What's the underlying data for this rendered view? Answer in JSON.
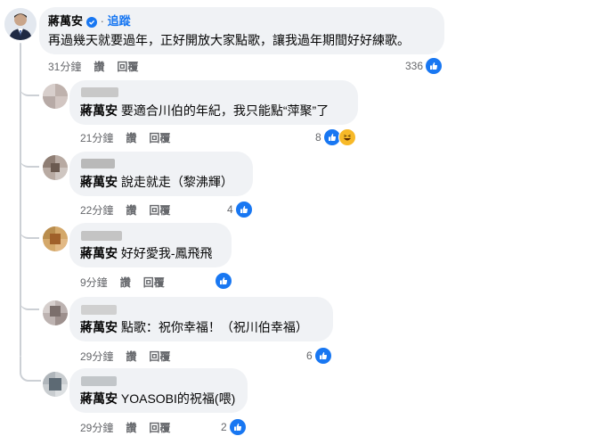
{
  "post": {
    "author": "蔣萬安",
    "separator": " · ",
    "follow_label": "追蹤",
    "text": "再過幾天就要過年，正好開放大家點歌，讓我過年期間好好練歌。",
    "time": "31分鐘",
    "like_label": "讚",
    "reply_label": "回覆",
    "reaction_count": "336"
  },
  "replies": [
    {
      "reply_to": "蔣萬安",
      "text": "要適合川伯的年紀，我只能點“萍聚”了",
      "time": "21分鐘",
      "like_label": "讚",
      "reply_label": "回覆",
      "reaction_count": "8",
      "reactions": [
        "like-icon",
        "haha-icon"
      ]
    },
    {
      "reply_to": "蔣萬安",
      "text": "說走就走（黎沸輝）",
      "time": "22分鐘",
      "like_label": "讚",
      "reply_label": "回覆",
      "reaction_count": "4",
      "reactions": [
        "like-icon"
      ]
    },
    {
      "reply_to": "蔣萬安",
      "text": "好好愛我-鳳飛飛",
      "time": "9分鐘",
      "like_label": "讚",
      "reply_label": "回覆",
      "reaction_count": "",
      "reactions": [
        "like-icon"
      ]
    },
    {
      "reply_to": "蔣萬安",
      "text": "點歌：祝你幸福！（祝川伯幸福）",
      "time": "29分鐘",
      "like_label": "讚",
      "reply_label": "回覆",
      "reaction_count": "6",
      "reactions": [
        "like-icon"
      ]
    },
    {
      "reply_to": "蔣萬安",
      "text": "YOASOBI的祝福(喂)",
      "time": "29分鐘",
      "like_label": "讚",
      "reply_label": "回覆",
      "reaction_count": "2",
      "reactions": [
        "like-icon"
      ]
    }
  ],
  "colors": {
    "accent": "#1877f2",
    "bubble": "#f0f2f5",
    "meta": "#65676b",
    "haha": "#f7b928"
  }
}
